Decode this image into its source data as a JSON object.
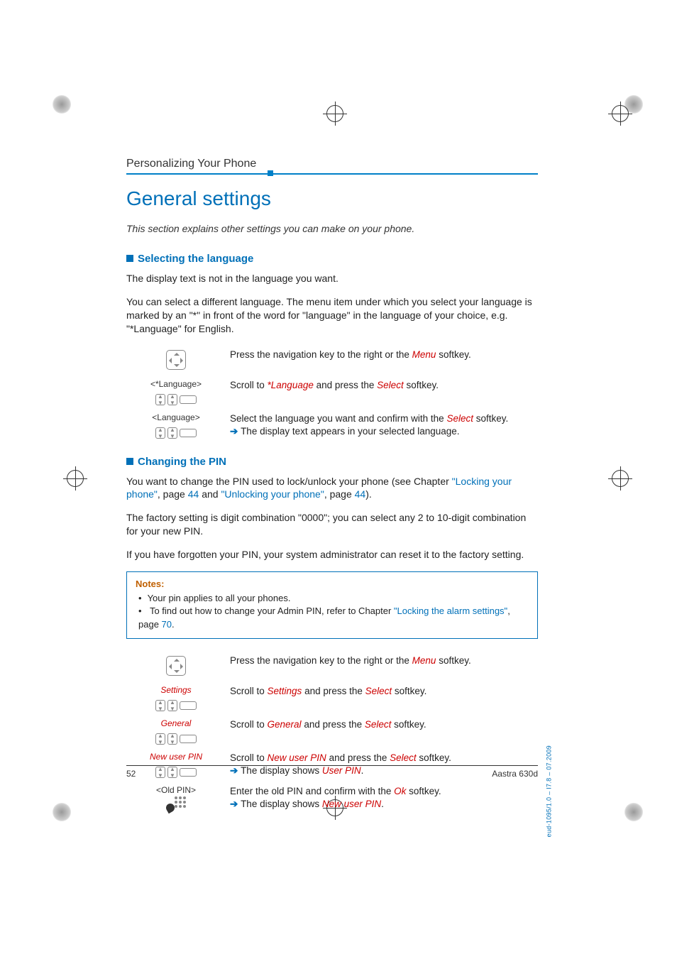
{
  "breadcrumb": "Personalizing Your Phone",
  "title": "General settings",
  "intro": "This section explains other settings you can make on your phone.",
  "section1": {
    "heading": "Selecting the language",
    "p1": "The display text is not in the language you want.",
    "p2": "You can select a different language. The menu item under which you select your language is marked by an \"*\" in front of the word for \"language\" in the language of your choice, e.g. \"*Language\" for English.",
    "steps": [
      {
        "label": "",
        "icon": "nav",
        "text_pre": "Press the navigation key to the right or the ",
        "em1": "Menu",
        "text_mid": " softkey.",
        "em2": "",
        "text_post": "",
        "result": ""
      },
      {
        "label": "<*Language>",
        "icon": "keys",
        "text_pre": "Scroll to ",
        "em1": "*Language",
        "text_mid": " and press the ",
        "em2": "Select",
        "text_post": " softkey.",
        "result": ""
      },
      {
        "label": "<Language>",
        "icon": "keys",
        "text_pre": "Select the language you want and confirm with the ",
        "em1": "Select",
        "text_mid": " softkey.",
        "em2": "",
        "text_post": "",
        "result": "The display text appears in your selected language."
      }
    ]
  },
  "section2": {
    "heading": "Changing the PIN",
    "p1_pre": "You want to change the PIN used to lock/unlock your phone (see Chapter ",
    "p1_link1": "\"Locking your phone\"",
    "p1_mid1": ", page ",
    "p1_page1": "44",
    "p1_and": " and ",
    "p1_link2": "\"Unlocking your phone\"",
    "p1_mid2": ", page ",
    "p1_page2": "44",
    "p1_end": ").",
    "p2": "The factory setting is digit combination \"0000\"; you can select any 2 to 10-digit combination for your new PIN.",
    "p3": "If you have forgotten your PIN, your system administrator can reset it to the factory setting.",
    "notes": {
      "title": "Notes:",
      "items": [
        {
          "pre": "Your pin applies to all your phones.",
          "link": "",
          "mid": "",
          "page": "",
          "post": ""
        },
        {
          "pre": "To find out how to change your Admin PIN, refer to Chapter ",
          "link": "\"Locking the alarm settings\"",
          "mid": ", page ",
          "page": "70",
          "post": "."
        }
      ]
    },
    "steps": [
      {
        "label": "",
        "icon": "nav",
        "text_pre": "Press the navigation key to the right or the ",
        "em1": "Menu",
        "text_mid": " softkey.",
        "em2": "",
        "text_post": "",
        "result": ""
      },
      {
        "label": "Settings",
        "label_class": "label-red",
        "icon": "keys",
        "text_pre": "Scroll to ",
        "em1": "Settings",
        "text_mid": " and press the ",
        "em2": "Select",
        "text_post": " softkey.",
        "result": ""
      },
      {
        "label": "General",
        "label_class": "label-red",
        "icon": "keys",
        "text_pre": "Scroll to ",
        "em1": "General",
        "text_mid": " and press the ",
        "em2": "Select",
        "text_post": " softkey.",
        "result": ""
      },
      {
        "label": "New user PIN",
        "label_class": "label-red",
        "icon": "keys",
        "text_pre": "Scroll to ",
        "em1": "New user PIN",
        "text_mid": " and press the ",
        "em2": "Select",
        "text_post": " softkey.",
        "result": "The display shows ",
        "result_em": "User PIN",
        "result_post": "."
      },
      {
        "label": "<Old PIN>",
        "label_class": "",
        "icon": "dial",
        "text_pre": "Enter the old PIN and confirm with the ",
        "em1": "Ok",
        "text_mid": " softkey.",
        "em2": "",
        "text_post": "",
        "result": "The display shows ",
        "result_em": "New user PIN",
        "result_post": "."
      }
    ]
  },
  "footer": {
    "page": "52",
    "model": "Aastra 630d"
  },
  "sidecode": "eud-1095/1.0 – I7.8 – 07.2009"
}
